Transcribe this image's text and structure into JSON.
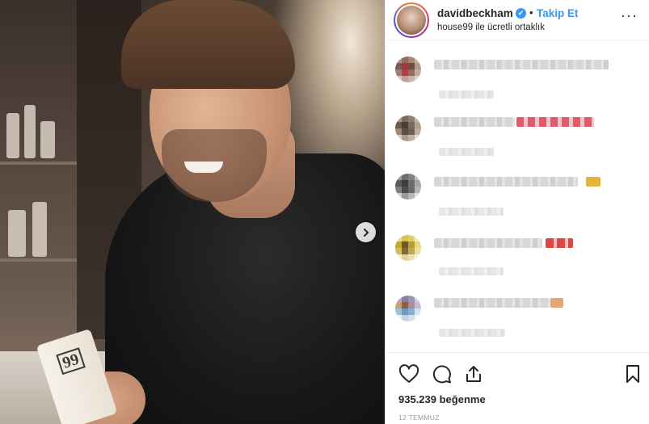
{
  "post": {
    "username": "davidbeckham",
    "verified_mark": "✔",
    "separator": "•",
    "follow_label": "Takip Et",
    "partnership": "house99 ile ücretli ortaklık",
    "more_icon": "more-horizontal-icon",
    "product_label": "99"
  },
  "engagement": {
    "likes": "935.239 beğenme",
    "date": "12 TEMMUZ"
  },
  "icons": {
    "like": "heart-icon",
    "comment": "comment-bubble-icon",
    "share": "share-icon",
    "save": "bookmark-icon",
    "next": "chevron-right-icon"
  },
  "colors": {
    "accent": "#3897f0",
    "text": "#262626",
    "muted": "#999999"
  }
}
